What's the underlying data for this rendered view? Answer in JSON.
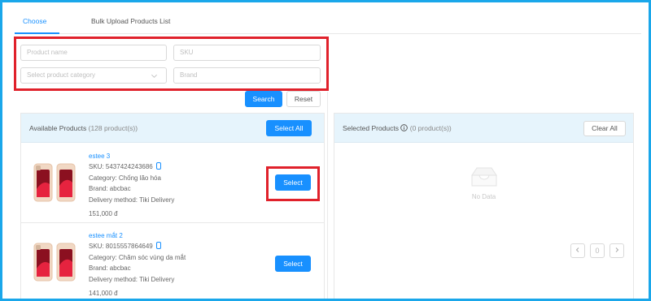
{
  "tabs": [
    {
      "label": "Choose",
      "active": true
    },
    {
      "label": "Bulk Upload Products List",
      "active": false
    }
  ],
  "filters": {
    "product_name_placeholder": "Product name",
    "sku_placeholder": "SKU",
    "category_placeholder": "Select product category",
    "brand_placeholder": "Brand",
    "search_label": "Search",
    "reset_label": "Reset"
  },
  "available": {
    "title": "Available Products",
    "count": "(128 product(s))",
    "select_all_label": "Select All",
    "products": [
      {
        "name": "estee 3",
        "sku": "SKU: 5437424243686",
        "category": "Category: Chống lão hóa",
        "brand": "Brand: abcbac",
        "delivery": "Delivery method: Tiki Delivery",
        "price": "151,000 đ",
        "select_label": "Select"
      },
      {
        "name": "estee mắt 2",
        "sku": "SKU: 8015557864649",
        "category": "Category: Chăm sóc vùng da mắt",
        "brand": "Brand: abcbac",
        "delivery": "Delivery method: Tiki Delivery",
        "price": "141,000 đ",
        "select_label": "Select"
      }
    ]
  },
  "selected": {
    "title": "Selected Products",
    "count": "(0 product(s))",
    "clear_all_label": "Clear All",
    "empty_text": "No Data",
    "page": "0",
    "prev_icon": "chevron-left",
    "next_icon": "chevron-right"
  },
  "colors": {
    "accent": "#1890ff",
    "highlight": "#e0212b",
    "frame": "#1aa7ea",
    "panel_header": "#e6f4fc"
  }
}
